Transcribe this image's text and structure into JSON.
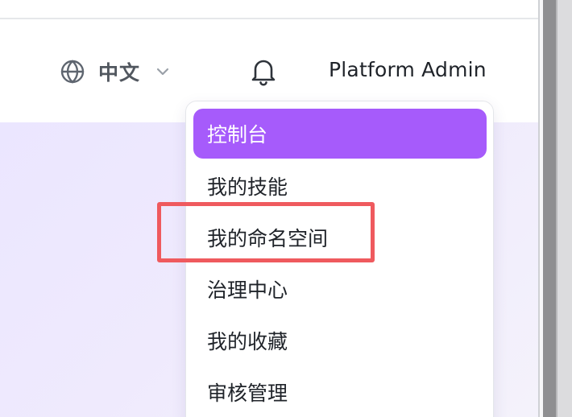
{
  "header": {
    "language_label": "中文",
    "user_name": "Platform Admin"
  },
  "icons": {
    "language": "globe-icon",
    "language_dropdown": "chevron-down-icon",
    "notifications": "bell-icon"
  },
  "user_menu": {
    "items": [
      {
        "label": "控制台",
        "active": true
      },
      {
        "label": "我的技能"
      },
      {
        "label": "我的命名空间"
      },
      {
        "label": "治理中心"
      },
      {
        "label": "我的收藏"
      },
      {
        "label": "审核管理"
      }
    ]
  },
  "colors": {
    "menu_active_bg": "#a65bfb",
    "highlight_border": "#ef5a5e",
    "hero_bg": "#ebe6ff",
    "icon_gray": "#5f6670"
  }
}
